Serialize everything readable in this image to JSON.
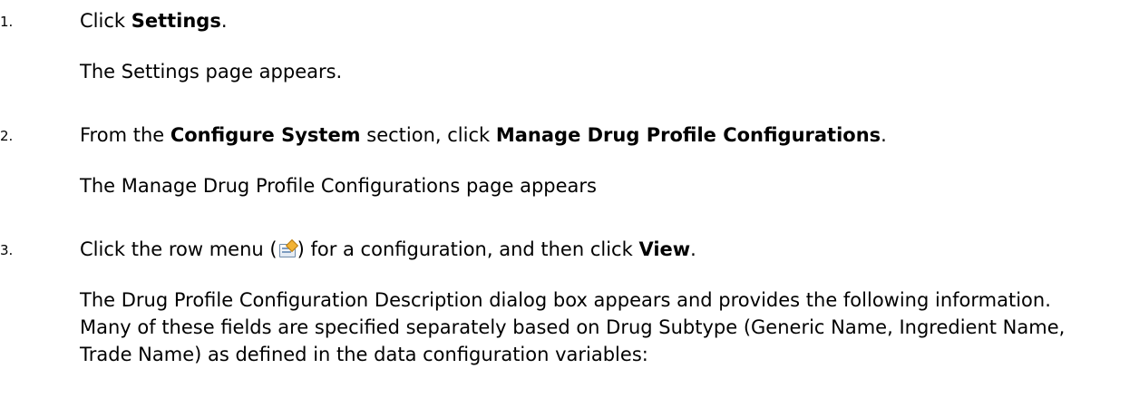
{
  "steps": [
    {
      "number": "1.",
      "text_prefix": "Click ",
      "text_bold": "Settings",
      "text_suffix": ".",
      "result": "The Settings page appears."
    },
    {
      "number": "2.",
      "text_prefix": "From the ",
      "text_bold": "Configure System",
      "text_middle": " section, click ",
      "text_bold2": "Manage Drug Profile Configurations",
      "text_suffix": ".",
      "result": "The Manage Drug Profile Configurations page appears"
    },
    {
      "number": "3.",
      "text_prefix": "Click the row menu (",
      "icon": "row-menu-icon",
      "text_middle": ") for a configuration, and then click ",
      "text_bold": "View",
      "text_suffix": ".",
      "result": "The Drug Profile Configuration Description dialog box appears and provides the following information. Many of these fields are specified separately based on Drug Subtype (Generic Name, Ingredient Name, Trade Name) as defined in the data configuration variables:"
    }
  ]
}
